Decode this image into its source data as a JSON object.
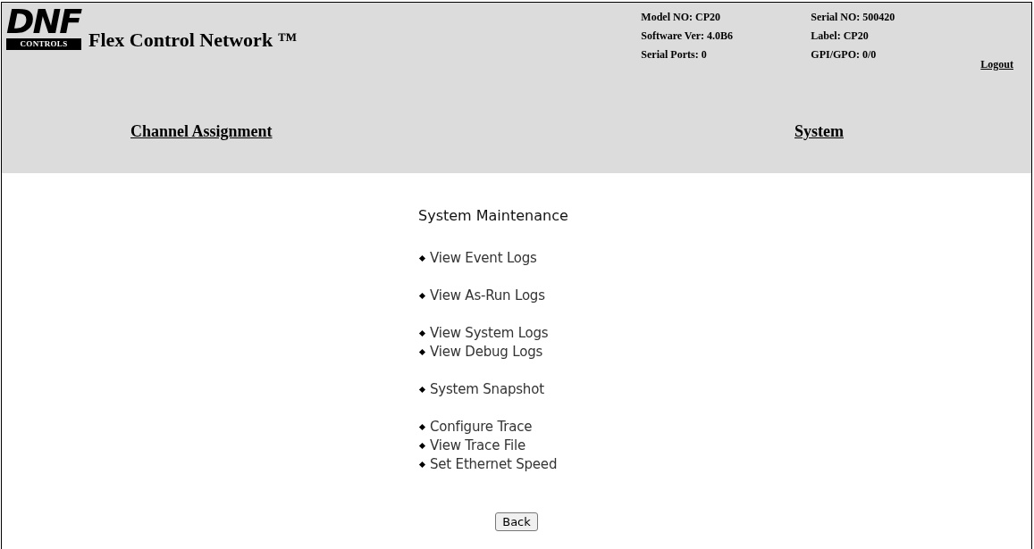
{
  "logo": {
    "mark": "DNF",
    "sub": "CONTROLS"
  },
  "app_title": "Flex Control Network ™",
  "device_info": [
    {
      "text": "Model NO: CP20"
    },
    {
      "text": "Serial NO: 500420"
    },
    {
      "text": "Software Ver: 4.0B6"
    },
    {
      "text": "Label: CP20"
    },
    {
      "text": "Serial Ports: 0"
    },
    {
      "text": "GPI/GPO: 0/0"
    }
  ],
  "logout": "Logout",
  "nav": [
    "Channel Assignment",
    "System"
  ],
  "heading": "System Maintenance",
  "menu_groups": [
    [
      "View Event Logs"
    ],
    [
      "View As-Run Logs"
    ],
    [
      "View System Logs",
      "View Debug Logs"
    ],
    [
      "System Snapshot"
    ],
    [
      "Configure Trace",
      "View Trace File",
      "Set Ethernet Speed"
    ]
  ],
  "back_button": "Back"
}
